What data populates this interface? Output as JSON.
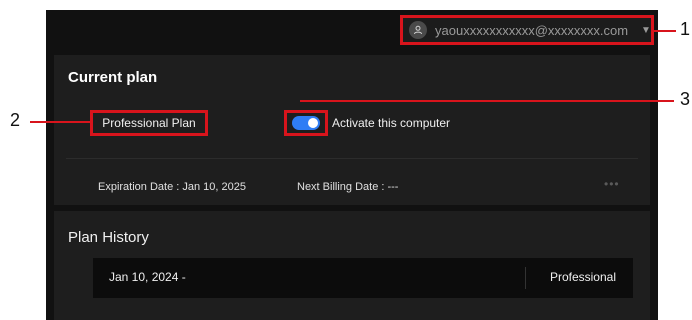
{
  "header": {
    "account_email": "yaouxxxxxxxxxxx@xxxxxxxx.com",
    "dropdown_caret": "▼"
  },
  "current_plan": {
    "title": "Current plan",
    "plan_name": "Professional Plan",
    "activate_label": "Activate this computer",
    "activate_on": true,
    "expiration": "Expiration Date : Jan 10, 2025",
    "next_billing": "Next Billing Date : ---",
    "more_label": "•••"
  },
  "plan_history": {
    "title": "Plan History",
    "rows": [
      {
        "date": "Jan 10, 2024 -",
        "plan": "Professional"
      }
    ]
  },
  "callouts": {
    "one": "1",
    "two": "2",
    "three": "3"
  },
  "colors": {
    "accent": "#2f7df5",
    "highlight": "#d8141c",
    "background": "#111111",
    "card": "#1e1e1e"
  }
}
